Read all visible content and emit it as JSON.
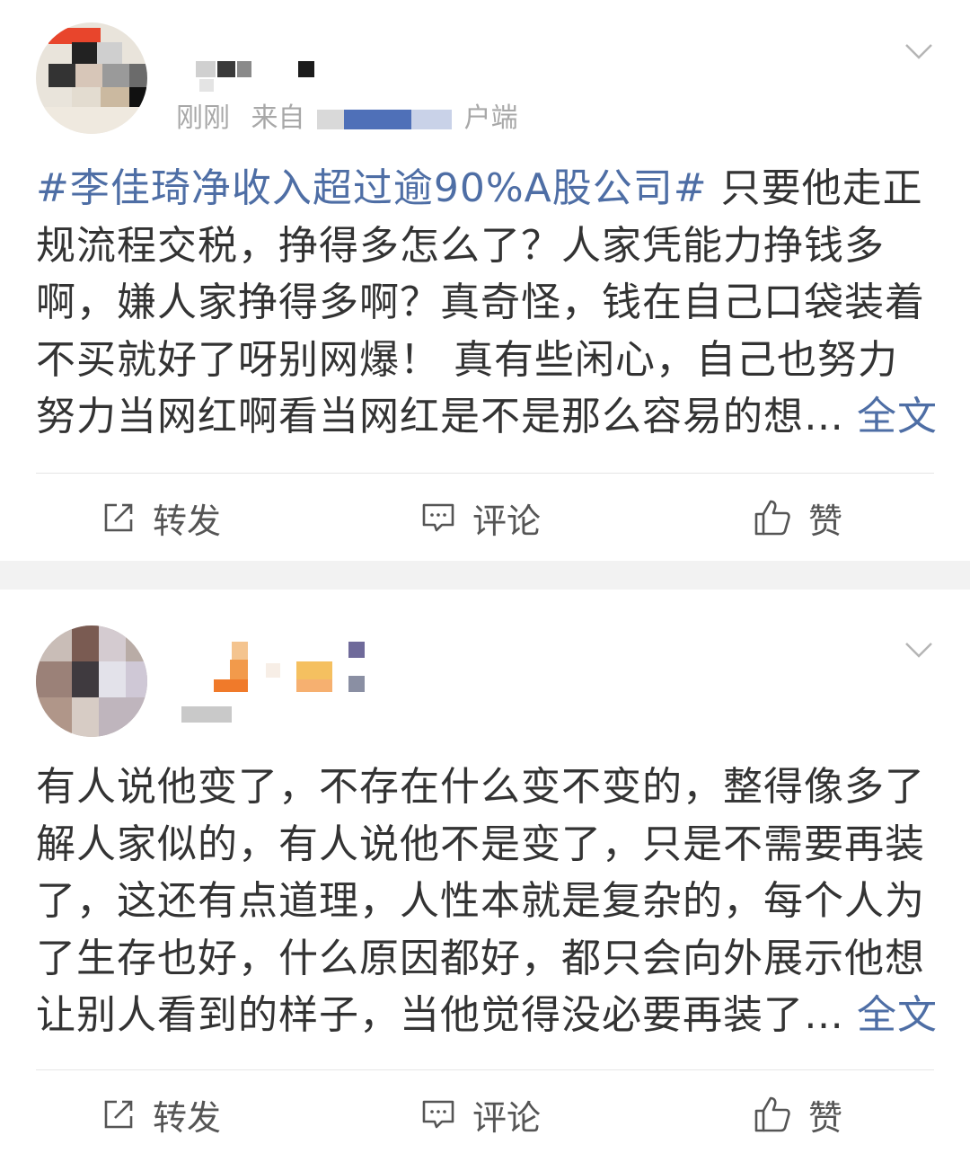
{
  "posts": [
    {
      "meta": {
        "time": "刚刚",
        "source_prefix": "来自",
        "source_suffix": "户端"
      },
      "text": {
        "hashtag": "#李佳琦净收入超过逾90%A股公司#",
        "line1_rest": " 只要他走正",
        "line2": "规流程交税，挣得多怎么了？人家凭能力挣钱多",
        "line3": "啊，嫌人家挣得多啊？真奇怪，钱在自己口袋装着",
        "line4": "不买就好了呀别网爆！  真有些闲心，自己也努力",
        "line5": "努力当网红啊看当网红是不是那么容易的想…"
      },
      "expand_label": "全文",
      "actions": {
        "repost": "转发",
        "comment": "评论",
        "like": "赞"
      }
    },
    {
      "text": {
        "line1": "有人说他变了，不存在什么变不变的，整得像多了",
        "line2": "解人家似的，有人说他不是变了，只是不需要再装",
        "line3": "了，这还有点道理，人性本就是复杂的，每个人为",
        "line4": "了生存也好，什么原因都好，都只会向外展示他想",
        "line5": "让别人看到的样子，当他觉得没必要再装了…"
      },
      "expand_label": "全文",
      "actions": {
        "repost": "转发",
        "comment": "评论",
        "like": "赞"
      }
    }
  ],
  "icons": {
    "repost": "repost-icon",
    "comment": "comment-icon",
    "like": "thumbs-up-icon",
    "menu": "chevron-down-icon"
  },
  "colors": {
    "link": "#4e6ea5",
    "text": "#333333",
    "meta": "#a8a8a8",
    "separator": "#f2f2f2"
  }
}
